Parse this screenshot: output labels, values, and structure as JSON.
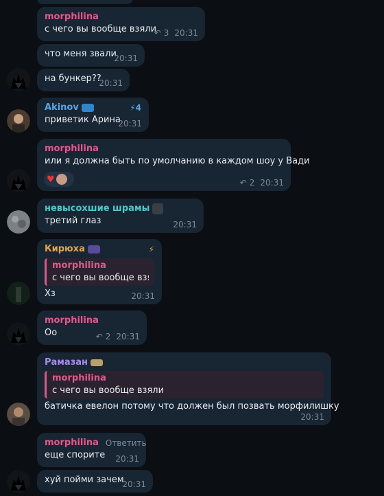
{
  "messages": {
    "m1": {
      "sender": "morphilina",
      "text": "с чего вы вообще взяли",
      "replies": "3",
      "time": "20:31"
    },
    "m2": {
      "text": "что меня звали",
      "time": "20:31"
    },
    "m3": {
      "text": "на бункер??",
      "time": "20:31"
    },
    "m4": {
      "sender": "Akinov",
      "badge": "4",
      "text": "приветик Арина",
      "time": "20:31"
    },
    "m5": {
      "sender": "morphilina",
      "text": "или я должна быть по умолчанию в каждом шоу у Вади",
      "replies": "2",
      "time": "20:31"
    },
    "m6": {
      "sender": "невысохшие шрамы",
      "text": "третий глаз",
      "time": "20:31"
    },
    "m7": {
      "sender": "Кирюха",
      "quote_name": "morphilina",
      "quote_text": "с чего вы вообще взя...",
      "text": "Хз",
      "time": "20:31"
    },
    "m8": {
      "sender": "morphilina",
      "text": "Оо",
      "replies": "2",
      "time": "20:31"
    },
    "m9": {
      "sender": "Рамазан",
      "quote_name": "morphilina",
      "quote_text": "с чего вы вообще взяли",
      "text": "батичка евелон потому что должен был позвать морфилишку",
      "time": "20:31"
    },
    "m10": {
      "sender": "morphilina",
      "hover_action": "Ответить",
      "text": "еще спорите",
      "time": "20:31"
    },
    "m11": {
      "text": "хуй пойми зачем",
      "time": "20:31"
    }
  },
  "colors": {
    "background": "#0b0e12",
    "bubble": "#182533",
    "morphilina": "#e05a8d",
    "akinov": "#5ba6e5",
    "shramy": "#53c7c9",
    "kiryukha": "#e8a54b",
    "ramazan": "#a98bf0"
  }
}
